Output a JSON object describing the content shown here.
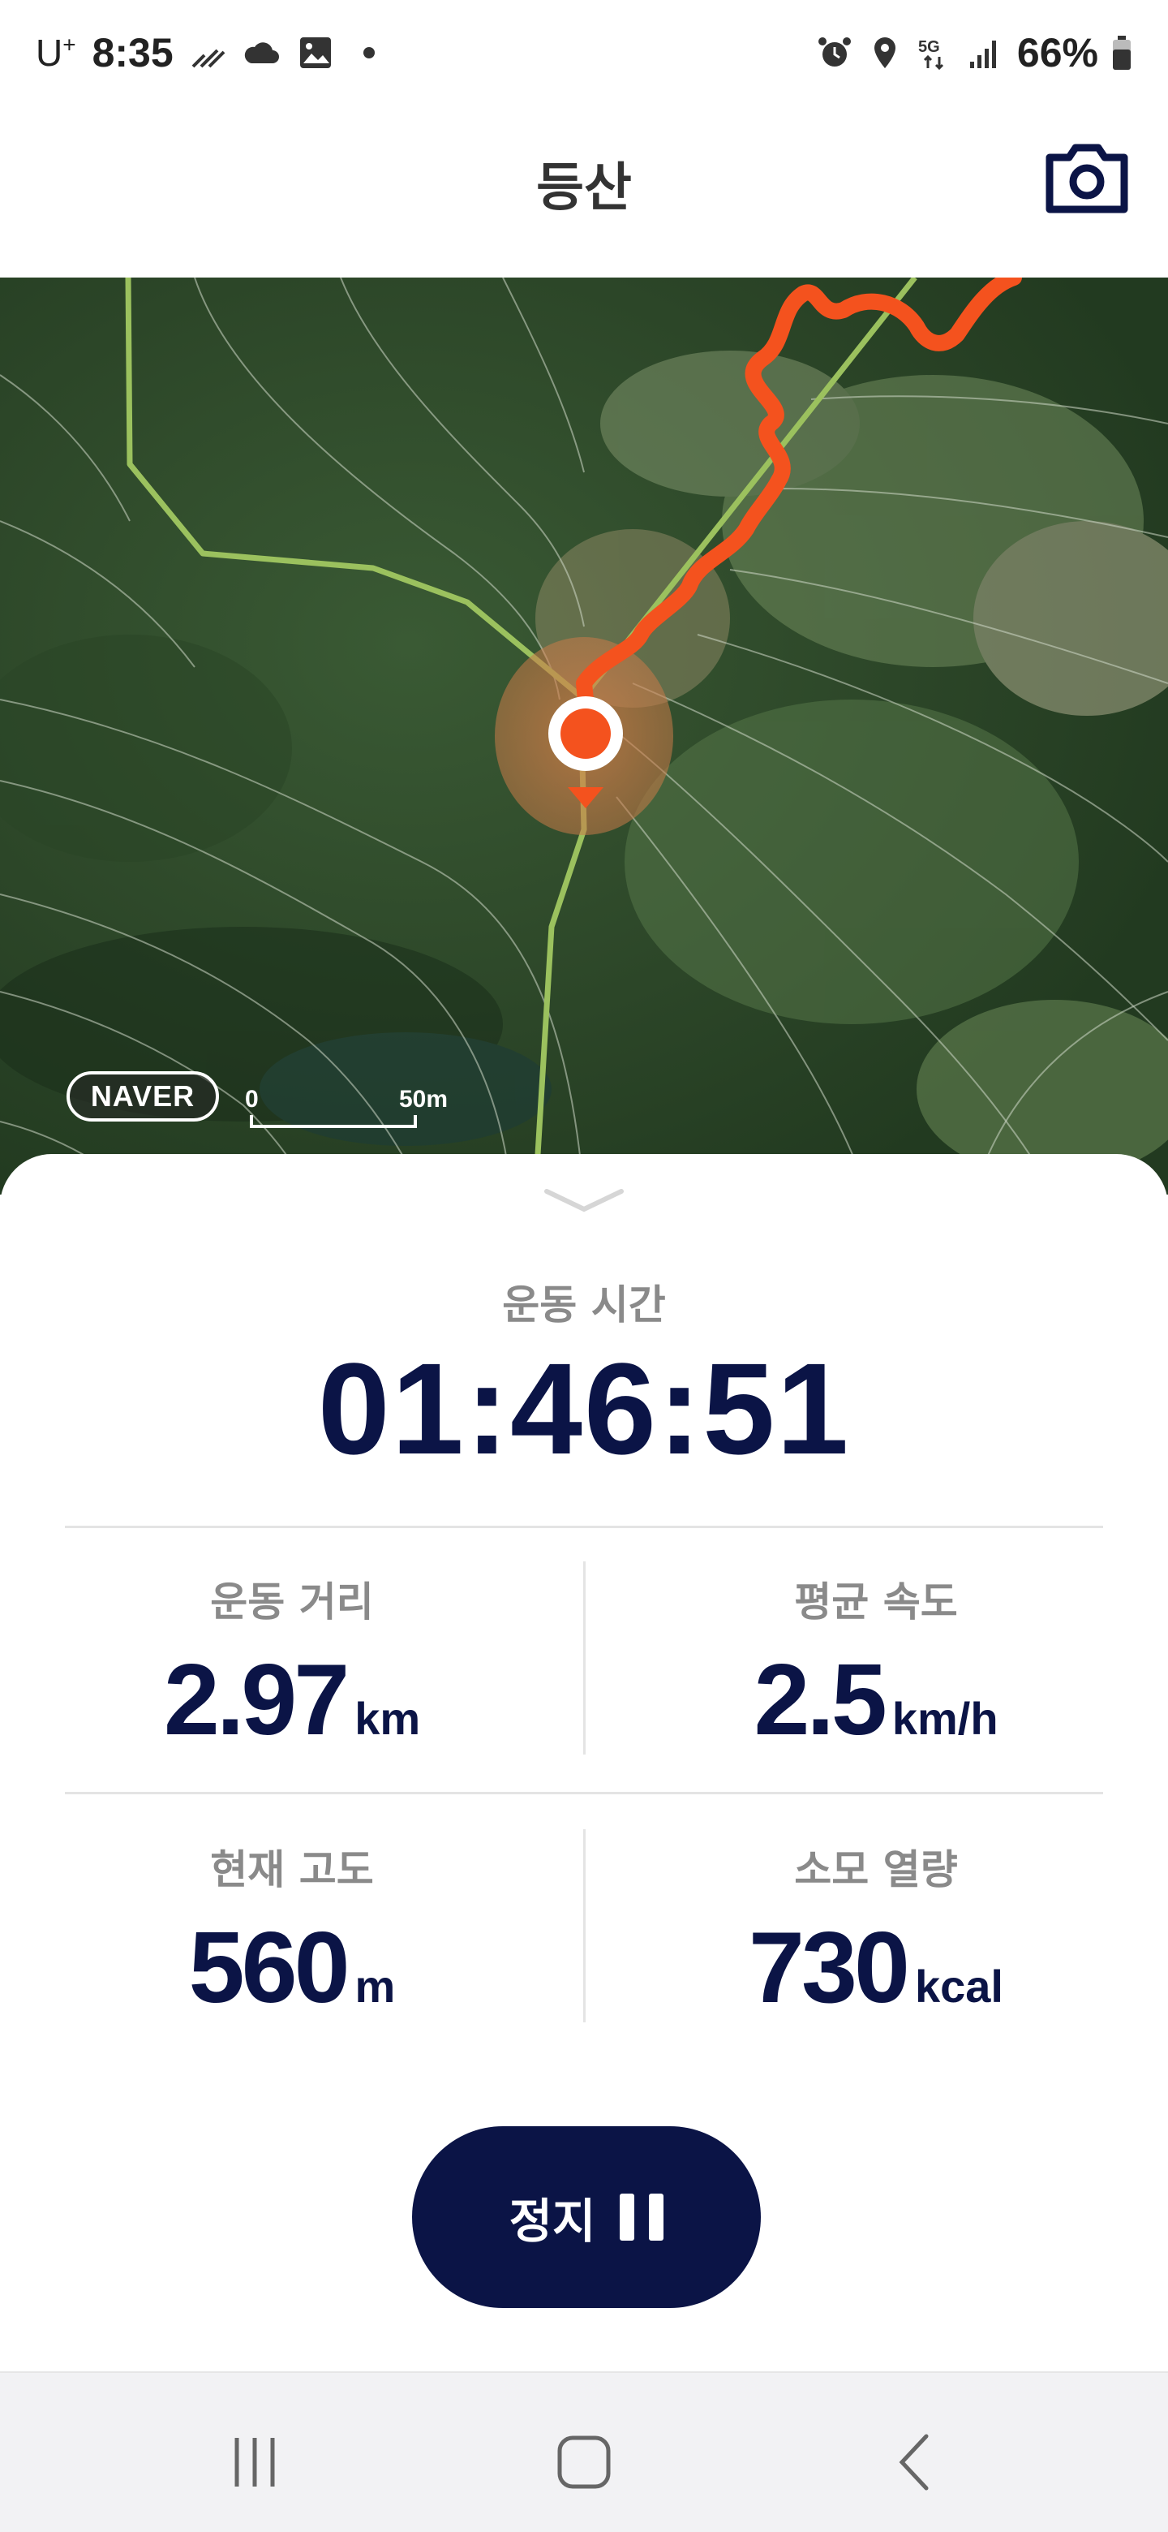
{
  "status_bar": {
    "carrier": "U",
    "carrier_sup": "+",
    "time": "8:35",
    "battery": "66%",
    "network": "5G",
    "icons_left": [
      "wifi-calling-icon",
      "cloud-icon",
      "gallery-icon",
      "dot-icon"
    ],
    "icons_right": [
      "alarm-icon",
      "location-icon",
      "5g-icon",
      "signal-icon",
      "battery-icon"
    ]
  },
  "header": {
    "title": "등산",
    "camera_icon": "camera-icon"
  },
  "map": {
    "provider_logo": "NAVER",
    "scale_start": "0",
    "scale_end": "50m",
    "colors": {
      "track": "#f4521e",
      "trail": "#9bc15e",
      "marker": "#f4521e"
    }
  },
  "workout": {
    "time_label": "운동 시간",
    "time_value": "01:46:51",
    "stats": [
      {
        "label": "운동 거리",
        "value": "2.97",
        "unit": "km"
      },
      {
        "label": "평균 속도",
        "value": "2.5",
        "unit": "km/h"
      },
      {
        "label": "현재 고도",
        "value": "560",
        "unit": "m"
      },
      {
        "label": "소모 열량",
        "value": "730",
        "unit": "kcal"
      }
    ],
    "stop_button": "정지",
    "colors": {
      "primary": "#0b1446"
    }
  },
  "navbar": {
    "buttons": [
      "recents-icon",
      "home-icon",
      "back-icon"
    ]
  }
}
